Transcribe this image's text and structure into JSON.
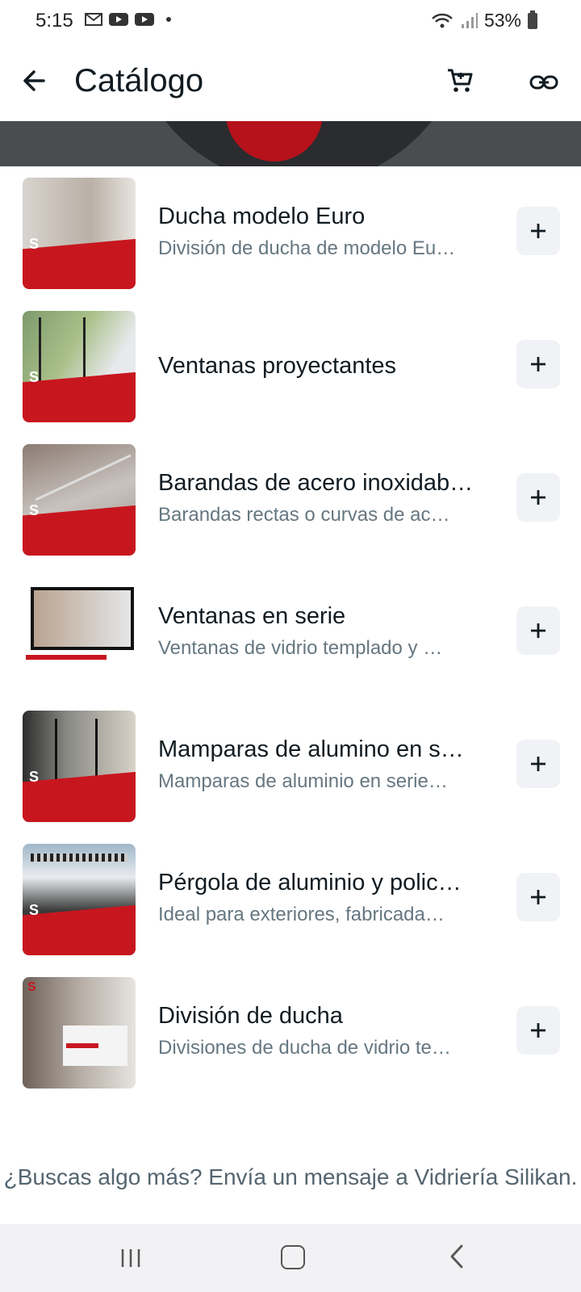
{
  "status_bar": {
    "time": "5:15",
    "battery": "53%"
  },
  "app_bar": {
    "title": "Catálogo"
  },
  "items": [
    {
      "title": "Ducha modelo Euro",
      "subtitle": "División de ducha de modelo Eu…"
    },
    {
      "title": "Ventanas proyectantes",
      "subtitle": ""
    },
    {
      "title": "Barandas de acero inoxidab…",
      "subtitle": "Barandas rectas o curvas de ac…"
    },
    {
      "title": "Ventanas en serie",
      "subtitle": "Ventanas de vidrio templado y …"
    },
    {
      "title": "Mamparas de alumino en s…",
      "subtitle": "Mamparas de aluminio en serie…"
    },
    {
      "title": "Pérgola de aluminio y polic…",
      "subtitle": "Ideal para exteriores, fabricada…"
    },
    {
      "title": "División de ducha",
      "subtitle": "Divisiones de ducha de vidrio te…"
    }
  ],
  "footer_text": "¿Buscas algo más? Envía un mensaje a Vidriería Silikan.",
  "colors": {
    "accent": "#c8161f",
    "text_primary": "#111b21",
    "text_secondary": "#667781",
    "button_bg": "#f0f2f5"
  },
  "icons": [
    "back-arrow-icon",
    "cart-icon",
    "link-icon",
    "plus-icon"
  ]
}
